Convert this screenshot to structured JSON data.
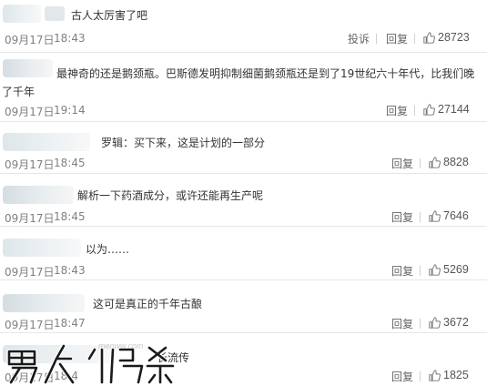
{
  "comments": [
    {
      "text": "古人太厉害了吧",
      "date": "09月17日",
      "time": "18:43",
      "report": "投诉",
      "reply": "回复",
      "likes": "28723"
    },
    {
      "text": "最神奇的还是鹅颈瓶。巴斯德发明抑制细菌鹅颈瓶还是到了19世纪六十年代，比我们晚了千年",
      "date": "09月17日",
      "time": "19:14",
      "reply": "回复",
      "likes": "27144"
    },
    {
      "text": "罗辑：买下来，这是计划的一部分",
      "date": "09月17日",
      "time": "18:45",
      "reply": "回复",
      "likes": "8828"
    },
    {
      "text": "解析一下药酒成分，或许还能再生产呢",
      "date": "09月17日",
      "time": "18:45",
      "reply": "回复",
      "likes": "7646"
    },
    {
      "text": "以为……",
      "date": "09月17日",
      "time": "18:43",
      "reply": "回复",
      "likes": "5269"
    },
    {
      "text": "这可是真正的千年古酿",
      "date": "09月17日",
      "time": "18:47",
      "reply": "回复",
      "likes": "3672"
    },
    {
      "text": "长流传",
      "date": "09月17日",
      "time": "18:4",
      "reply": "回复",
      "likes": "1825"
    }
  ],
  "watermark": {
    "logo_text": "男人世界",
    "url": "menww.com"
  },
  "colors": {
    "text": "#333333",
    "meta": "#808080",
    "divider": "#e6e6e6",
    "blur": "#e3e8eb"
  },
  "icons": {
    "like": "thumbs-up-icon"
  }
}
